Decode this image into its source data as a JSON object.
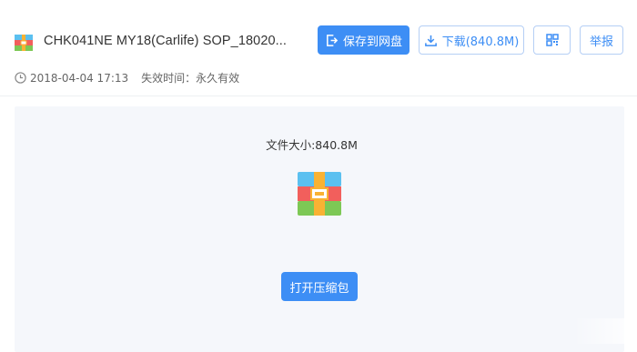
{
  "file": {
    "title": "CHK041NE MY18(Carlife) SOP_18020...",
    "icon": "archive-icon",
    "date": "2018-04-04 17:13",
    "expiry_label": "失效时间：永久有效"
  },
  "toolbar": {
    "save_label": "保存到网盘",
    "download_label": "下载(840.8M)",
    "qr_icon": "qrcode-icon",
    "report_label": "举报"
  },
  "preview": {
    "size_text": "文件大小:840.8M",
    "open_label": "打开压缩包"
  },
  "colors": {
    "accent": "#3d8ef5",
    "content_bg": "#f5f7fb",
    "outline_border": "#b5cff5"
  }
}
